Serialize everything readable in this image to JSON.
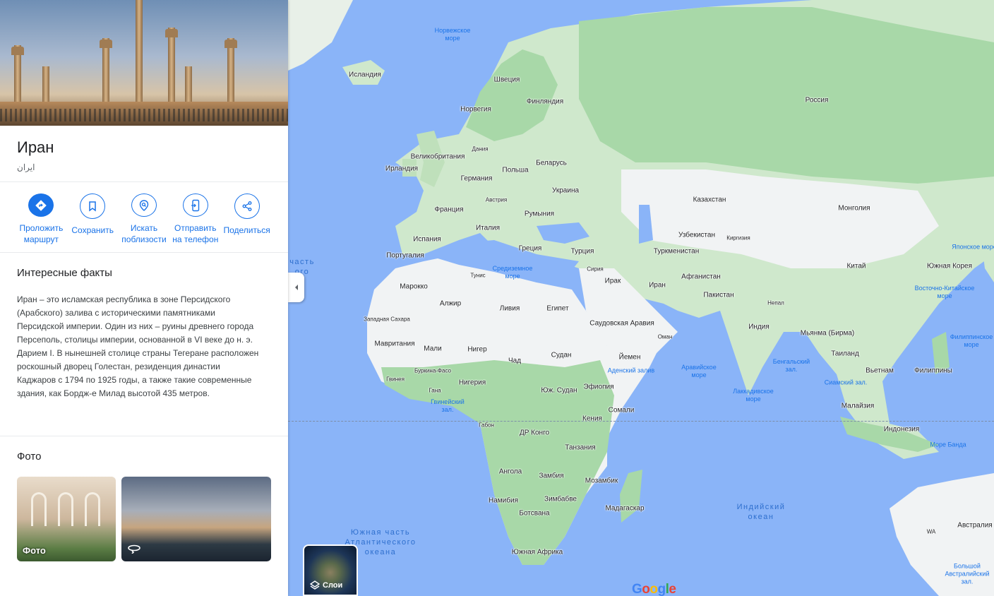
{
  "place": {
    "name": "Иран",
    "native_name": "ایران"
  },
  "actions": [
    {
      "label": "Проложить\nмаршрут",
      "icon": "directions-icon"
    },
    {
      "label": "Сохранить",
      "icon": "bookmark-icon"
    },
    {
      "label": "Искать\nпоблизости",
      "icon": "nearby-search-icon"
    },
    {
      "label": "Отправить\nна телефон",
      "icon": "send-to-phone-icon"
    },
    {
      "label": "Поделиться",
      "icon": "share-icon"
    }
  ],
  "facts": {
    "heading": "Интересные факты",
    "text": "Иран – это исламская республика в зоне Персидского (Арабского) залива с историческими памятниками Персидской империи. Один из них – руины древнего города Персеполь, столицы империи, основанной в VI веке до н. э. Дарием I. В нынешней столице страны Тегеране расположен роскошный дворец Голестан, резиденция династии Каджаров с 1794 по 1925 годы, а также такие современные здания, как Бордж-е Милад высотой 435 метров."
  },
  "photos": {
    "heading": "Фото",
    "items": [
      {
        "label": "Фото"
      },
      {
        "label": "",
        "icon": "360-view-icon"
      }
    ]
  },
  "map": {
    "layers_label": "Слои",
    "logo": "Google",
    "countries": [
      "Исландия",
      "Швеция",
      "Финляндия",
      "Норвегия",
      "Дания",
      "Великобритания",
      "Ирландия",
      "Германия",
      "Польша",
      "Беларусь",
      "Украина",
      "Австрия",
      "Франция",
      "Румыния",
      "Италия",
      "Испания",
      "Португалия",
      "Греция",
      "Турция",
      "Россия",
      "Казахстан",
      "Монголия",
      "Узбекистан",
      "Киргизия",
      "Туркменистан",
      "Сирия",
      "Ирак",
      "Иран",
      "Афганистан",
      "Пакистан",
      "Непал",
      "Китай",
      "Южная Корея",
      "Индия",
      "Мьянма (Бирма)",
      "Таиланд",
      "Вьетнам",
      "Филиппины",
      "Малайзия",
      "Индонезия",
      "Марокко",
      "Тунис",
      "Алжир",
      "Ливия",
      "Египет",
      "Саудовская Аравия",
      "Оман",
      "Йемен",
      "Западная Сахара",
      "Мавритания",
      "Мали",
      "Нигер",
      "Чад",
      "Судан",
      "Буркина-Фасо",
      "Гвинея",
      "Гана",
      "Нигерия",
      "Юж. Судан",
      "Эфиопия",
      "Сомали",
      "Кения",
      "Габон",
      "ДР Конго",
      "Танзания",
      "Ангола",
      "Замбия",
      "Мозамбик",
      "Намибия",
      "Зимбабве",
      "Ботсвана",
      "Мадагаскар",
      "Южная Африка",
      "Австралия",
      "WA"
    ],
    "waters": [
      "Норвежское\nморе",
      "Средиземное\nморе",
      "Аравийское\nморе",
      "Аденский залив",
      "Бенгальский\nзал.",
      "Лаккадивское\nморе",
      "Сиамский зал.",
      "Японское море",
      "Восточно-Китайское\nморе",
      "Филиппинское\nморе",
      "Море Банда",
      "Гвинейский\nзал.",
      "Большой\nАвстралийский\nзал."
    ],
    "oceans": [
      "Индийский\nокеан",
      "Южная часть\nАтлантического\nокеана",
      "часть\nого"
    ]
  }
}
